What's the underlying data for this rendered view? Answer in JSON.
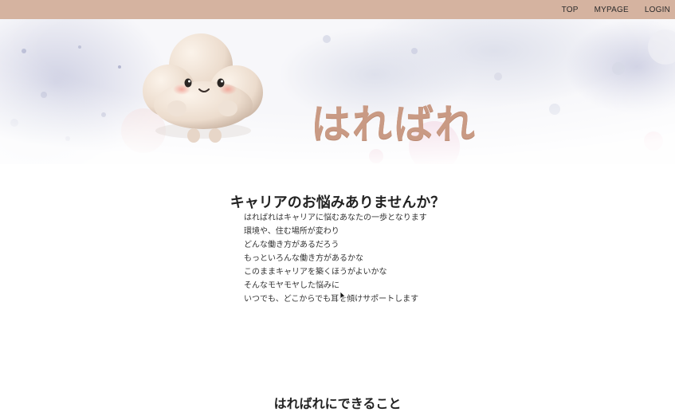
{
  "nav": {
    "items": [
      {
        "label": "TOP"
      },
      {
        "label": "MYPAGE"
      },
      {
        "label": "LOGIN"
      }
    ]
  },
  "hero": {
    "title": "はればれ",
    "mascot": "cloud-mascot"
  },
  "intro": {
    "heading": "キャリアのお悩みありませんか？",
    "lines": [
      "はればれはキャリアに悩むあなたの一歩となります",
      "環境や、住む場所が変わり",
      "どんな働き方があるだろう",
      "もっといろんな働き方があるかな",
      "このままキャリアを築くほうがよいかな",
      "そんなモヤモヤした悩みに",
      "いつでも、どこからでも耳を傾けサポートします"
    ]
  },
  "features": {
    "heading": "はればれにできること"
  },
  "colors": {
    "topbar": "#d5b3a0",
    "title": "#c99a84"
  }
}
